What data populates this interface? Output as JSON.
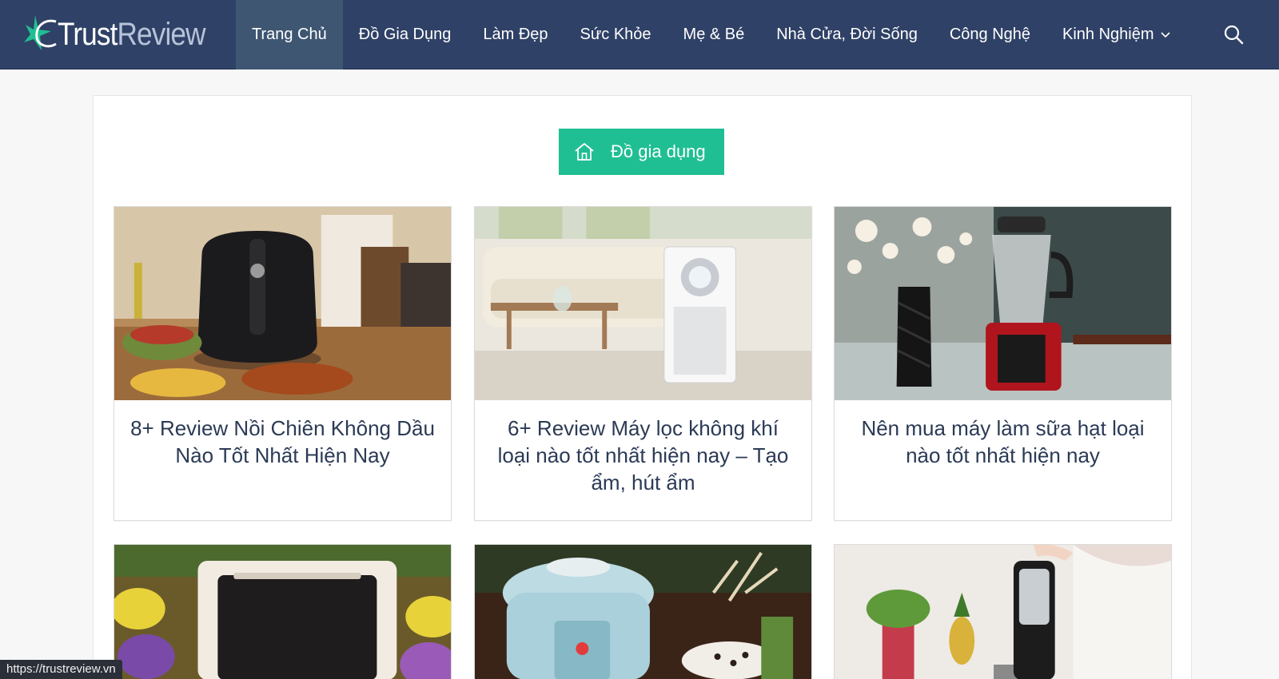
{
  "logo": {
    "part1": "Trust",
    "part2": "Review"
  },
  "nav": {
    "items": [
      {
        "label": "Trang Chủ"
      },
      {
        "label": "Đồ Gia Dụng"
      },
      {
        "label": "Làm Đẹp"
      },
      {
        "label": "Sức Khỏe"
      },
      {
        "label": "Mẹ & Bé"
      },
      {
        "label": "Nhà Cửa, Đời Sống"
      },
      {
        "label": "Công Nghệ"
      },
      {
        "label": "Kinh Nghiệm"
      }
    ],
    "active_index": 0,
    "dropdown_item": "Kinh Nghiệm",
    "search_icon": "search-icon"
  },
  "category": {
    "label": "Đồ gia dụng",
    "icon": "home-icon"
  },
  "posts": [
    {
      "title": "8+ Review Nồi Chiên Không Dầu Nào Tốt Nhất Hiện Nay",
      "image": "air fryer"
    },
    {
      "title": "6+ Review Máy lọc không khí loại nào tốt nhất hiện nay – Tạo ẩm, hút ẩm",
      "image": "air purifier"
    },
    {
      "title": "Nên mua máy làm sữa hạt loại nào tốt nhất hiện nay",
      "image": "soy milk maker"
    },
    {
      "title": "",
      "image": "oven"
    },
    {
      "title": "",
      "image": "slow cooker"
    },
    {
      "title": "",
      "image": "juicer"
    }
  ],
  "status_bar": {
    "url": "https://trustreview.vn"
  },
  "colors": {
    "header": "#2f4166",
    "active_tab": "#3e5672",
    "accent": "#20bf93",
    "title_text": "#2b3a55"
  }
}
